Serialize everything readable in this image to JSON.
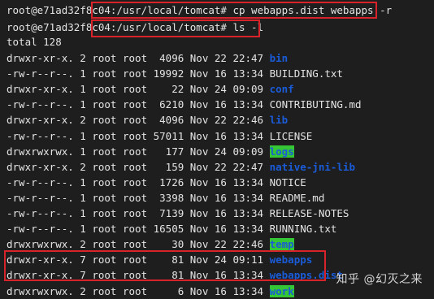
{
  "terminal": {
    "prompts": [
      {
        "prompt": "root@e71ad32f8c04:/usr/local/tomcat#",
        "command": "cp webapps.dist webapps -r"
      },
      {
        "prompt": "root@e71ad32f8c04:/usr/local/tomcat#",
        "command": "ls -l"
      }
    ],
    "total": "total 128",
    "entries": [
      {
        "perms": "drwxr-xr-x.",
        "links": "2",
        "owner": "root",
        "group": "root",
        "size": "4096",
        "month": "Nov",
        "day": "22",
        "time": "22:47",
        "name": "bin",
        "type": "dir"
      },
      {
        "perms": "-rw-r--r--.",
        "links": "1",
        "owner": "root",
        "group": "root",
        "size": "19992",
        "month": "Nov",
        "day": "16",
        "time": "13:34",
        "name": "BUILDING.txt",
        "type": "file"
      },
      {
        "perms": "drwxr-xr-x.",
        "links": "1",
        "owner": "root",
        "group": "root",
        "size": "22",
        "month": "Nov",
        "day": "24",
        "time": "09:09",
        "name": "conf",
        "type": "dir"
      },
      {
        "perms": "-rw-r--r--.",
        "links": "1",
        "owner": "root",
        "group": "root",
        "size": "6210",
        "month": "Nov",
        "day": "16",
        "time": "13:34",
        "name": "CONTRIBUTING.md",
        "type": "file"
      },
      {
        "perms": "drwxr-xr-x.",
        "links": "2",
        "owner": "root",
        "group": "root",
        "size": "4096",
        "month": "Nov",
        "day": "22",
        "time": "22:46",
        "name": "lib",
        "type": "dir"
      },
      {
        "perms": "-rw-r--r--.",
        "links": "1",
        "owner": "root",
        "group": "root",
        "size": "57011",
        "month": "Nov",
        "day": "16",
        "time": "13:34",
        "name": "LICENSE",
        "type": "file"
      },
      {
        "perms": "drwxrwxrwx.",
        "links": "1",
        "owner": "root",
        "group": "root",
        "size": "177",
        "month": "Nov",
        "day": "24",
        "time": "09:09",
        "name": "logs",
        "type": "dir-hl"
      },
      {
        "perms": "drwxr-xr-x.",
        "links": "2",
        "owner": "root",
        "group": "root",
        "size": "159",
        "month": "Nov",
        "day": "22",
        "time": "22:47",
        "name": "native-jni-lib",
        "type": "dir"
      },
      {
        "perms": "-rw-r--r--.",
        "links": "1",
        "owner": "root",
        "group": "root",
        "size": "1726",
        "month": "Nov",
        "day": "16",
        "time": "13:34",
        "name": "NOTICE",
        "type": "file"
      },
      {
        "perms": "-rw-r--r--.",
        "links": "1",
        "owner": "root",
        "group": "root",
        "size": "3398",
        "month": "Nov",
        "day": "16",
        "time": "13:34",
        "name": "README.md",
        "type": "file"
      },
      {
        "perms": "-rw-r--r--.",
        "links": "1",
        "owner": "root",
        "group": "root",
        "size": "7139",
        "month": "Nov",
        "day": "16",
        "time": "13:34",
        "name": "RELEASE-NOTES",
        "type": "file"
      },
      {
        "perms": "-rw-r--r--.",
        "links": "1",
        "owner": "root",
        "group": "root",
        "size": "16505",
        "month": "Nov",
        "day": "16",
        "time": "13:34",
        "name": "RUNNING.txt",
        "type": "file"
      },
      {
        "perms": "drwxrwxrwx.",
        "links": "2",
        "owner": "root",
        "group": "root",
        "size": "30",
        "month": "Nov",
        "day": "22",
        "time": "22:46",
        "name": "temp",
        "type": "dir-hl"
      },
      {
        "perms": "drwxr-xr-x.",
        "links": "7",
        "owner": "root",
        "group": "root",
        "size": "81",
        "month": "Nov",
        "day": "24",
        "time": "09:11",
        "name": "webapps",
        "type": "dir"
      },
      {
        "perms": "drwxr-xr-x.",
        "links": "7",
        "owner": "root",
        "group": "root",
        "size": "81",
        "month": "Nov",
        "day": "16",
        "time": "13:34",
        "name": "webapps.dist",
        "type": "dir"
      },
      {
        "perms": "drwxrwxrwx.",
        "links": "2",
        "owner": "root",
        "group": "root",
        "size": "6",
        "month": "Nov",
        "day": "16",
        "time": "13:34",
        "name": "work",
        "type": "dir-hl"
      }
    ]
  },
  "watermark": "知乎 @幻灭之来",
  "colors": {
    "background": "#1e1e1e",
    "text": "#e4e4e4",
    "directory": "#1a5bd8",
    "highlight_bg": "#35c636",
    "annotation_box": "#d9232b"
  }
}
